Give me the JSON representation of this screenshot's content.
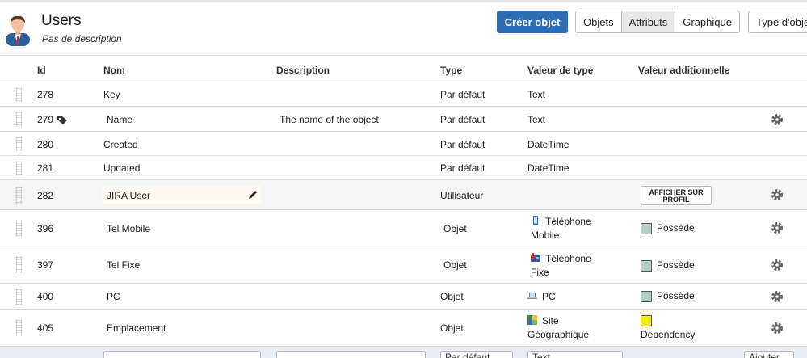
{
  "header": {
    "title": "Users",
    "description": "Pas de description",
    "create_button": "Créer objet",
    "views": [
      "Objets",
      "Attributs",
      "Graphique"
    ],
    "active_view": "Attributs",
    "type_button": "Type d'objet"
  },
  "table": {
    "columns": [
      "Id",
      "Nom",
      "Description",
      "Type",
      "Valeur de type",
      "Valeur additionnelle"
    ],
    "rows": [
      {
        "id": "278",
        "nom": "Key",
        "description": "",
        "type": "Par défaut",
        "valeur_type": "Text",
        "icon": "",
        "additional": ""
      },
      {
        "id": "279",
        "nom": "Name",
        "description": "The name of the object",
        "type": "Par défaut",
        "valeur_type": "Text",
        "icon": "tag-icon",
        "additional": ""
      },
      {
        "id": "280",
        "nom": "Created",
        "description": "",
        "type": "Par défaut",
        "valeur_type": "DateTime",
        "icon": "",
        "additional": ""
      },
      {
        "id": "281",
        "nom": "Updated",
        "description": "",
        "type": "Par défaut",
        "valeur_type": "DateTime",
        "icon": "",
        "additional": ""
      },
      {
        "id": "282",
        "nom": "JIRA User",
        "description": "",
        "type": "Utilisateur",
        "valeur_type": "",
        "icon": "",
        "additional": "AFFICHER SUR PROFIL"
      },
      {
        "id": "396",
        "nom": "Tel Mobile",
        "description": "",
        "type": "Objet",
        "valeur_type_line1": "Téléphone",
        "valeur_type_line2": "Mobile",
        "icon": "mobile-phone-icon",
        "additional": "Possède",
        "swatch": "#b4cfc4"
      },
      {
        "id": "397",
        "nom": "Tel Fixe",
        "description": "",
        "type": "Objet",
        "valeur_type_line1": "Téléphone",
        "valeur_type_line2": "Fixe",
        "icon": "desk-phone-icon",
        "additional": "Possède",
        "swatch": "#b4cfc4"
      },
      {
        "id": "400",
        "nom": "PC",
        "description": "",
        "type": "Objet",
        "valeur_type": "PC",
        "icon": "laptop-icon",
        "additional": "Possède",
        "swatch": "#b4cfc4"
      },
      {
        "id": "405",
        "nom": "Emplacement",
        "description": "",
        "type": "Objet",
        "valeur_type_line1": "Site",
        "valeur_type_line2": "Géographique",
        "icon": "map-icon",
        "additional": "Dependency",
        "swatch": "#f2f200"
      }
    ]
  },
  "footer": {
    "type_select": "Par défaut",
    "value_select": "Text",
    "add_button": "Ajouter"
  },
  "colors": {
    "primary": "#2d6fb7",
    "swatch_possede": "#b4cfc4",
    "swatch_dependency": "#f2f200"
  }
}
